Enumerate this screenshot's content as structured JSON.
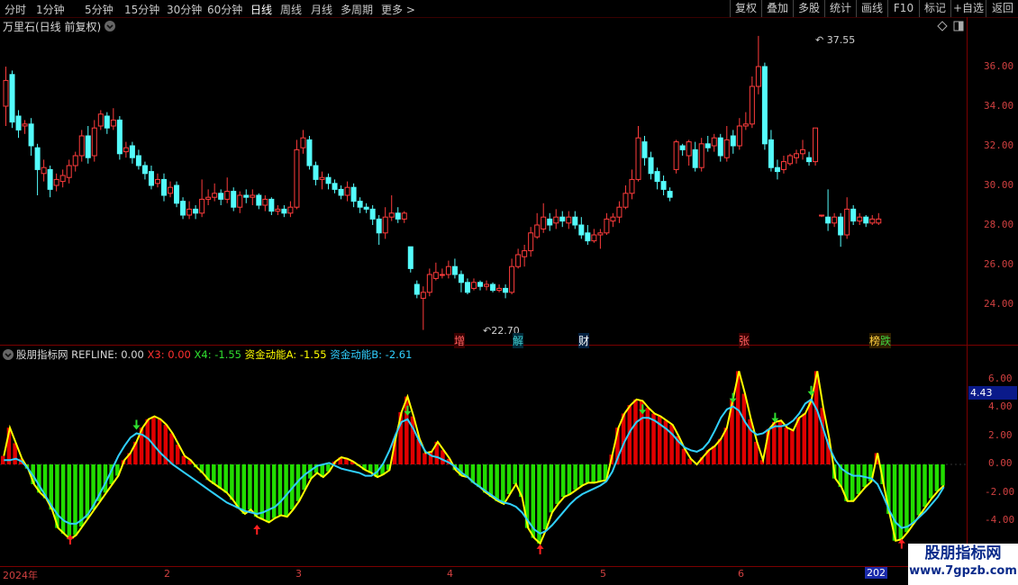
{
  "top_tabs": [
    "分时",
    "1分钟",
    "5分钟",
    "15分钟",
    "30分钟",
    "60分钟",
    "日线",
    "周线",
    "月线",
    "多周期",
    "更多"
  ],
  "active_tab": "日线",
  "more_chevron": ">",
  "right_buttons": [
    "复权",
    "叠加",
    "多股",
    "统计",
    "画线",
    "F10",
    "标记",
    "+自选",
    "返回"
  ],
  "main_chart": {
    "title": "万里石(日线 前复权)",
    "price_ticks": [
      "36.00",
      "34.00",
      "32.00",
      "30.00",
      "28.00",
      "26.00",
      "24.00"
    ],
    "high_label": "37.55",
    "low_label": "22.70",
    "events": [
      {
        "text": "增",
        "color": "#ff6060"
      },
      {
        "text": "解",
        "color": "#40d0d0"
      },
      {
        "text": "财",
        "color": "#ffffff"
      },
      {
        "text": "张",
        "color": "#ff6060"
      },
      {
        "text": "榜",
        "color": "#ffd040"
      },
      {
        "text": "跌",
        "color": "#40d040"
      }
    ]
  },
  "indicator": {
    "name": "股朋指标网",
    "refline": "REFLINE: 0.00",
    "x3": "X3: 0.00",
    "x4": "X4: -1.55",
    "fund_a": "资金动能A: -1.55",
    "fund_b": "资金动能B: -2.61",
    "ticks": [
      "6.00",
      "4.00",
      "2.00",
      "0.00",
      "-2.00",
      "-4.00"
    ],
    "current_value": "4.43"
  },
  "date_axis": [
    "2024年",
    "2",
    "3",
    "4",
    "5",
    "6",
    "202"
  ],
  "watermark": {
    "line1": "股朋指标网",
    "line2": "www.7gpzb.com"
  },
  "colors": {
    "up": "#ff3c3c",
    "down": "#54fcfc",
    "hist_pos": "#e00000",
    "hist_neg": "#22dd00",
    "line_a": "#ffff00",
    "line_b": "#30d0ff",
    "grid": "#7a0000"
  },
  "chart_data": {
    "type": "candlestick",
    "price_range": [
      22.7,
      37.55
    ],
    "candles": [
      [
        34.0,
        35.3,
        33.0,
        36.0
      ],
      [
        35.6,
        33.2,
        32.9,
        35.8
      ],
      [
        33.5,
        32.8,
        32.4,
        33.8
      ],
      [
        33.0,
        33.1,
        32.6,
        33.3
      ],
      [
        33.1,
        32.0,
        31.5,
        33.4
      ],
      [
        31.9,
        30.8,
        29.5,
        32.1
      ],
      [
        30.6,
        30.9,
        30.2,
        31.3
      ],
      [
        30.8,
        29.8,
        29.4,
        31.0
      ],
      [
        30.0,
        30.3,
        29.7,
        30.6
      ],
      [
        30.2,
        30.5,
        29.9,
        30.8
      ],
      [
        30.4,
        31.0,
        30.1,
        31.3
      ],
      [
        31.0,
        31.5,
        30.7,
        31.7
      ],
      [
        31.5,
        32.5,
        31.2,
        32.8
      ],
      [
        32.5,
        31.4,
        31.1,
        33.0
      ],
      [
        31.5,
        32.9,
        31.2,
        33.3
      ],
      [
        33.0,
        33.6,
        32.8,
        33.8
      ],
      [
        33.5,
        32.9,
        32.6,
        33.7
      ],
      [
        33.0,
        33.3,
        32.8,
        33.9
      ],
      [
        33.3,
        31.6,
        31.3,
        33.5
      ],
      [
        31.7,
        31.9,
        31.4,
        32.2
      ],
      [
        32.0,
        31.4,
        31.1,
        32.2
      ],
      [
        31.5,
        31.0,
        30.8,
        31.8
      ],
      [
        31.0,
        30.6,
        30.3,
        31.2
      ],
      [
        30.7,
        30.0,
        29.8,
        31.0
      ],
      [
        30.1,
        30.3,
        29.9,
        30.6
      ],
      [
        30.3,
        29.5,
        29.2,
        30.6
      ],
      [
        29.6,
        29.9,
        29.4,
        30.2
      ],
      [
        30.0,
        29.1,
        28.9,
        30.2
      ],
      [
        29.2,
        28.5,
        28.3,
        29.4
      ],
      [
        28.5,
        28.8,
        28.3,
        29.2
      ],
      [
        28.8,
        28.6,
        28.3,
        29.0
      ],
      [
        28.6,
        29.3,
        28.4,
        30.3
      ],
      [
        29.3,
        29.4,
        29.0,
        29.8
      ],
      [
        29.4,
        29.6,
        29.2,
        30.1
      ],
      [
        29.6,
        29.3,
        29.0,
        29.8
      ],
      [
        29.3,
        29.7,
        29.1,
        30.4
      ],
      [
        29.7,
        28.9,
        28.7,
        29.9
      ],
      [
        28.9,
        29.5,
        28.6,
        29.7
      ],
      [
        29.5,
        29.4,
        29.1,
        29.8
      ],
      [
        29.4,
        29.5,
        29.0,
        29.8
      ],
      [
        29.5,
        29.0,
        28.8,
        29.6
      ],
      [
        29.0,
        29.3,
        28.7,
        29.5
      ],
      [
        29.3,
        28.7,
        28.5,
        29.4
      ],
      [
        28.7,
        28.8,
        28.5,
        29.0
      ],
      [
        28.8,
        28.6,
        28.4,
        29.0
      ],
      [
        28.6,
        28.9,
        28.4,
        29.2
      ],
      [
        28.9,
        31.8,
        28.8,
        32.3
      ],
      [
        31.9,
        32.4,
        31.6,
        32.8
      ],
      [
        32.3,
        31.0,
        30.8,
        32.5
      ],
      [
        31.0,
        30.3,
        30.0,
        31.2
      ],
      [
        30.3,
        30.4,
        29.8,
        30.7
      ],
      [
        30.4,
        30.1,
        29.8,
        30.6
      ],
      [
        30.1,
        29.8,
        29.6,
        30.3
      ],
      [
        29.8,
        29.5,
        29.3,
        30.0
      ],
      [
        29.5,
        29.9,
        29.2,
        30.2
      ],
      [
        29.9,
        29.2,
        28.9,
        30.1
      ],
      [
        29.2,
        28.9,
        28.6,
        29.4
      ],
      [
        28.9,
        28.8,
        28.6,
        29.1
      ],
      [
        28.8,
        28.3,
        28.0,
        29.0
      ],
      [
        28.3,
        27.6,
        27.0,
        28.5
      ],
      [
        27.6,
        28.4,
        27.3,
        28.9
      ],
      [
        28.4,
        28.6,
        28.2,
        29.5
      ],
      [
        28.6,
        28.3,
        28.1,
        28.9
      ],
      [
        28.3,
        28.6,
        28.1,
        28.7
      ],
      [
        26.9,
        25.8,
        25.6,
        26.9
      ],
      [
        25.0,
        24.5,
        24.3,
        25.2
      ],
      [
        24.3,
        24.6,
        22.7,
        24.9
      ],
      [
        24.6,
        25.5,
        24.4,
        25.8
      ],
      [
        25.3,
        25.6,
        25.2,
        26.1
      ],
      [
        25.5,
        25.5,
        25.3,
        25.8
      ],
      [
        25.5,
        25.9,
        25.3,
        26.2
      ],
      [
        25.9,
        25.5,
        25.3,
        26.3
      ],
      [
        25.5,
        25.1,
        24.6,
        25.7
      ],
      [
        25.1,
        24.6,
        24.5,
        25.3
      ],
      [
        24.8,
        25.1,
        24.7,
        25.3
      ],
      [
        25.1,
        24.9,
        24.7,
        25.2
      ],
      [
        24.9,
        25.0,
        24.7,
        25.2
      ],
      [
        25.0,
        24.7,
        24.6,
        25.1
      ],
      [
        24.7,
        24.8,
        24.6,
        25.0
      ],
      [
        24.8,
        24.6,
        24.3,
        25.0
      ],
      [
        24.6,
        25.9,
        24.5,
        26.3
      ],
      [
        25.9,
        26.5,
        25.8,
        26.8
      ],
      [
        26.4,
        26.7,
        25.9,
        27.0
      ],
      [
        26.7,
        27.6,
        26.4,
        27.9
      ],
      [
        27.4,
        28.0,
        27.3,
        28.6
      ],
      [
        27.8,
        28.4,
        27.6,
        29.1
      ],
      [
        28.3,
        28.0,
        27.7,
        28.6
      ],
      [
        28.1,
        28.4,
        27.8,
        28.8
      ],
      [
        28.4,
        28.2,
        27.9,
        28.7
      ],
      [
        28.1,
        28.4,
        27.8,
        28.7
      ],
      [
        28.4,
        28.0,
        27.8,
        28.7
      ],
      [
        28.0,
        27.5,
        27.3,
        28.4
      ],
      [
        27.6,
        27.2,
        27.0,
        28.0
      ],
      [
        27.2,
        27.5,
        27.1,
        27.8
      ],
      [
        27.5,
        27.6,
        26.8,
        27.8
      ],
      [
        27.6,
        28.3,
        27.5,
        28.6
      ],
      [
        28.2,
        28.4,
        27.9,
        28.6
      ],
      [
        28.4,
        28.9,
        28.1,
        29.2
      ],
      [
        28.9,
        29.6,
        28.8,
        30.0
      ],
      [
        29.6,
        30.3,
        29.3,
        30.8
      ],
      [
        30.3,
        32.4,
        30.2,
        33.0
      ],
      [
        32.2,
        31.4,
        31.0,
        32.5
      ],
      [
        31.4,
        30.6,
        30.3,
        31.7
      ],
      [
        30.7,
        30.2,
        29.8,
        30.9
      ],
      [
        30.2,
        29.8,
        29.5,
        30.5
      ],
      [
        29.7,
        29.4,
        29.2,
        29.9
      ],
      [
        30.8,
        32.2,
        30.6,
        32.3
      ],
      [
        32.0,
        31.8,
        31.5,
        32.1
      ],
      [
        31.5,
        32.2,
        31.0,
        32.3
      ],
      [
        31.8,
        30.9,
        30.7,
        32.2
      ],
      [
        30.9,
        32.1,
        30.7,
        32.4
      ],
      [
        32.1,
        31.9,
        31.7,
        32.5
      ],
      [
        32.0,
        32.4,
        31.7,
        32.6
      ],
      [
        32.4,
        31.5,
        31.2,
        32.6
      ],
      [
        31.4,
        32.3,
        31.2,
        33.0
      ],
      [
        32.5,
        32.0,
        31.6,
        32.8
      ],
      [
        32.0,
        33.0,
        31.8,
        33.4
      ],
      [
        33.0,
        33.1,
        32.8,
        33.7
      ],
      [
        33.1,
        35.0,
        32.9,
        35.5
      ],
      [
        35.0,
        36.0,
        34.6,
        37.55
      ],
      [
        36.0,
        32.1,
        31.8,
        36.2
      ],
      [
        32.3,
        30.9,
        30.7,
        32.8
      ],
      [
        30.9,
        30.7,
        30.3,
        31.3
      ],
      [
        30.8,
        31.2,
        30.6,
        31.5
      ],
      [
        31.1,
        31.5,
        31.0,
        31.6
      ],
      [
        31.4,
        31.6,
        31.1,
        31.8
      ],
      [
        31.6,
        31.8,
        31.3,
        32.3
      ],
      [
        31.4,
        31.2,
        31.0,
        31.7
      ],
      [
        31.2,
        32.9,
        31.0,
        32.9
      ],
      [
        28.5,
        28.5,
        28.4,
        28.5
      ],
      [
        28.4,
        28.1,
        27.7,
        29.8
      ],
      [
        28.1,
        28.4,
        27.9,
        28.6
      ],
      [
        28.4,
        27.5,
        26.9,
        28.6
      ],
      [
        27.5,
        28.8,
        27.3,
        29.4
      ],
      [
        28.8,
        28.2,
        28.0,
        29.0
      ],
      [
        28.2,
        28.4,
        28.0,
        28.6
      ],
      [
        28.4,
        28.1,
        27.9,
        28.5
      ],
      [
        28.1,
        28.3,
        28.0,
        28.5
      ],
      [
        28.1,
        28.3,
        28.0,
        28.6
      ]
    ],
    "oscillator": {
      "y_range": [
        -5.6,
        7.6
      ],
      "histogram": [
        0.6,
        2.6,
        1.5,
        0.4,
        -0.3,
        -1.4,
        -2.0,
        -2.4,
        -3.2,
        -4.5,
        -4.9,
        -5.3,
        -5.0,
        -4.4,
        -3.8,
        -3.2,
        -2.6,
        -2.0,
        -1.4,
        -0.8,
        0.3,
        0.8,
        1.6,
        2.6,
        3.2,
        3.4,
        3.2,
        2.8,
        2.2,
        1.4,
        0.6,
        0.3,
        -0.2,
        -0.6,
        -1.1,
        -1.4,
        -1.7,
        -2.0,
        -2.5,
        -3.1,
        -3.5,
        -3.2,
        -3.7,
        -3.9,
        -4.1,
        -3.8,
        -3.6,
        -3.7,
        -3.2,
        -2.6,
        -1.8,
        -1.0,
        -0.6,
        -0.9,
        -0.5,
        0.2,
        0.5,
        0.4,
        0.2,
        -0.1,
        -0.4,
        -0.6,
        -0.9,
        -0.7,
        -0.4,
        1.8,
        3.7,
        4.8,
        3.4,
        1.8,
        0.8,
        0.9,
        1.6,
        1.0,
        0.4,
        -0.4,
        -0.8,
        -0.9,
        -1.3,
        -1.6,
        -2.0,
        -2.3,
        -2.6,
        -2.8,
        -2.1,
        -1.4,
        -2.3,
        -4.5,
        -5.2,
        -5.6,
        -4.6,
        -3.4,
        -2.8,
        -2.3,
        -2.1,
        -1.8,
        -1.5,
        -1.3,
        -1.3,
        -1.2,
        -1.1,
        0.7,
        2.6,
        3.6,
        4.2,
        4.6,
        4.5,
        4.0,
        3.6,
        3.4,
        3.1,
        2.8,
        2.0,
        1.1,
        0.4,
        0.0,
        0.5,
        1.0,
        1.3,
        1.8,
        2.6,
        4.6,
        6.6,
        5.0,
        3.2,
        1.6,
        0.3,
        2.5,
        3.0,
        3.1,
        2.6,
        2.4,
        3.3,
        3.6,
        4.5,
        6.6,
        4.0,
        1.8,
        -1.0,
        -1.6,
        -2.6,
        -2.6,
        -2.1,
        -1.6,
        -1.2,
        0.8,
        -1.4,
        -3.5,
        -5.4,
        -5.3,
        -4.8,
        -4.2,
        -3.6,
        -3.0,
        -2.4,
        -1.9,
        -1.5
      ],
      "line_b": [
        0.3,
        0.3,
        0.4,
        0.2,
        -0.3,
        -0.9,
        -1.6,
        -2.3,
        -3.0,
        -3.6,
        -4.0,
        -4.2,
        -4.2,
        -3.9,
        -3.5,
        -2.8,
        -2.0,
        -1.2,
        -0.3,
        0.6,
        1.3,
        1.9,
        2.2,
        2.1,
        1.8,
        1.3,
        0.8,
        0.4,
        0.0,
        -0.3,
        -0.6,
        -0.9,
        -1.2,
        -1.5,
        -1.8,
        -2.1,
        -2.4,
        -2.7,
        -2.9,
        -3.1,
        -3.3,
        -3.4,
        -3.5,
        -3.4,
        -3.2,
        -3.0,
        -2.6,
        -2.1,
        -1.6,
        -1.1,
        -0.7,
        -0.4,
        -0.1,
        0.0,
        0.1,
        -0.1,
        -0.3,
        -0.4,
        -0.5,
        -0.6,
        -0.8,
        -0.8,
        -0.5,
        0.1,
        1.0,
        2.1,
        3.0,
        3.2,
        2.5,
        1.6,
        0.9,
        0.6,
        0.5,
        0.3,
        0.1,
        -0.2,
        -0.6,
        -0.9,
        -1.3,
        -1.6,
        -1.9,
        -2.2,
        -2.5,
        -2.7,
        -2.8,
        -3.0,
        -3.4,
        -4.0,
        -4.6,
        -4.9,
        -4.7,
        -4.3,
        -3.8,
        -3.3,
        -2.8,
        -2.4,
        -2.1,
        -1.9,
        -1.7,
        -1.5,
        -1.2,
        -0.5,
        0.6,
        1.6,
        2.4,
        3.0,
        3.3,
        3.3,
        3.1,
        2.8,
        2.5,
        2.1,
        1.6,
        1.2,
        1.0,
        0.9,
        1.1,
        1.6,
        2.4,
        3.3,
        3.9,
        4.1,
        3.8,
        3.0,
        2.4,
        2.1,
        2.2,
        2.5,
        2.7,
        2.7,
        2.8,
        3.1,
        3.6,
        4.3,
        4.6,
        3.8,
        2.5,
        1.2,
        0.3,
        -0.3,
        -0.6,
        -0.8,
        -0.8,
        -0.9,
        -1.0,
        -1.4,
        -2.3,
        -3.3,
        -4.1,
        -4.5,
        -4.4,
        -4.1,
        -3.7,
        -3.3,
        -2.8,
        -2.3,
        -1.6
      ]
    }
  }
}
